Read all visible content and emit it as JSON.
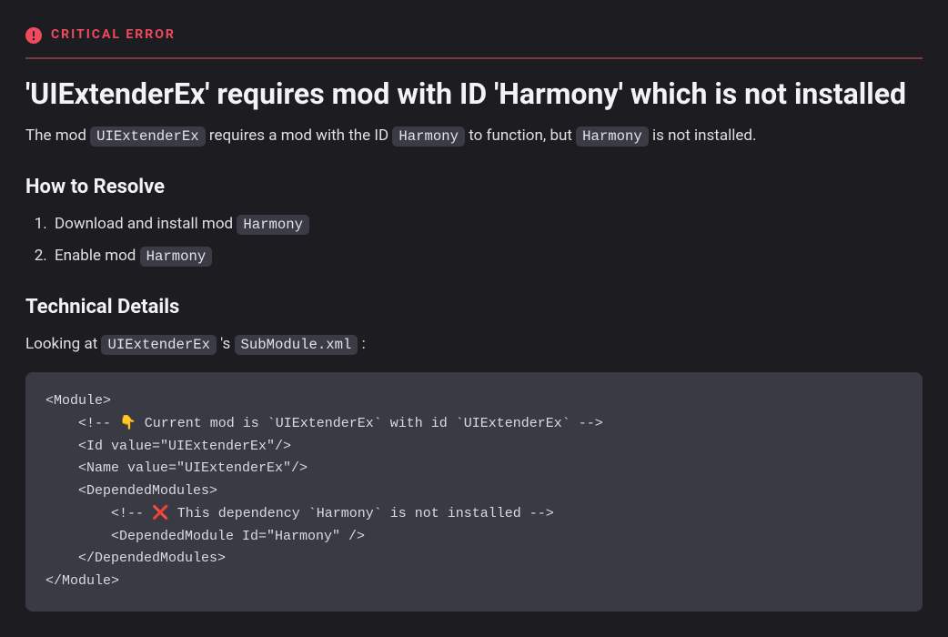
{
  "banner": {
    "label": "CRITICAL ERROR"
  },
  "title": "'UIExtenderEx' requires mod with ID 'Harmony' which is not installed",
  "description": {
    "pre": "The mod ",
    "mod": "UIExtenderEx",
    "mid1": " requires a mod with the ID ",
    "dep1": "Harmony",
    "mid2": " to function, but ",
    "dep2": "Harmony",
    "post": " is not installed."
  },
  "resolve": {
    "heading": "How to Resolve",
    "step1_pre": "Download and install mod ",
    "step1_mod": "Harmony",
    "step2_pre": "Enable mod ",
    "step2_mod": "Harmony"
  },
  "technical": {
    "heading": "Technical Details",
    "intro_pre": "Looking at ",
    "intro_mod": "UIExtenderEx",
    "intro_mid": " 's ",
    "intro_file": "SubModule.xml",
    "intro_post": " :",
    "code": "<Module>\n    <!-- 👇 Current mod is `UIExtenderEx` with id `UIExtenderEx` -->\n    <Id value=\"UIExtenderEx\"/>\n    <Name value=\"UIExtenderEx\"/>\n    <DependedModules>\n        <!-- ❌ This dependency `Harmony` is not installed -->\n        <DependedModule Id=\"Harmony\" />\n    </DependedModules>\n</Module>"
  }
}
